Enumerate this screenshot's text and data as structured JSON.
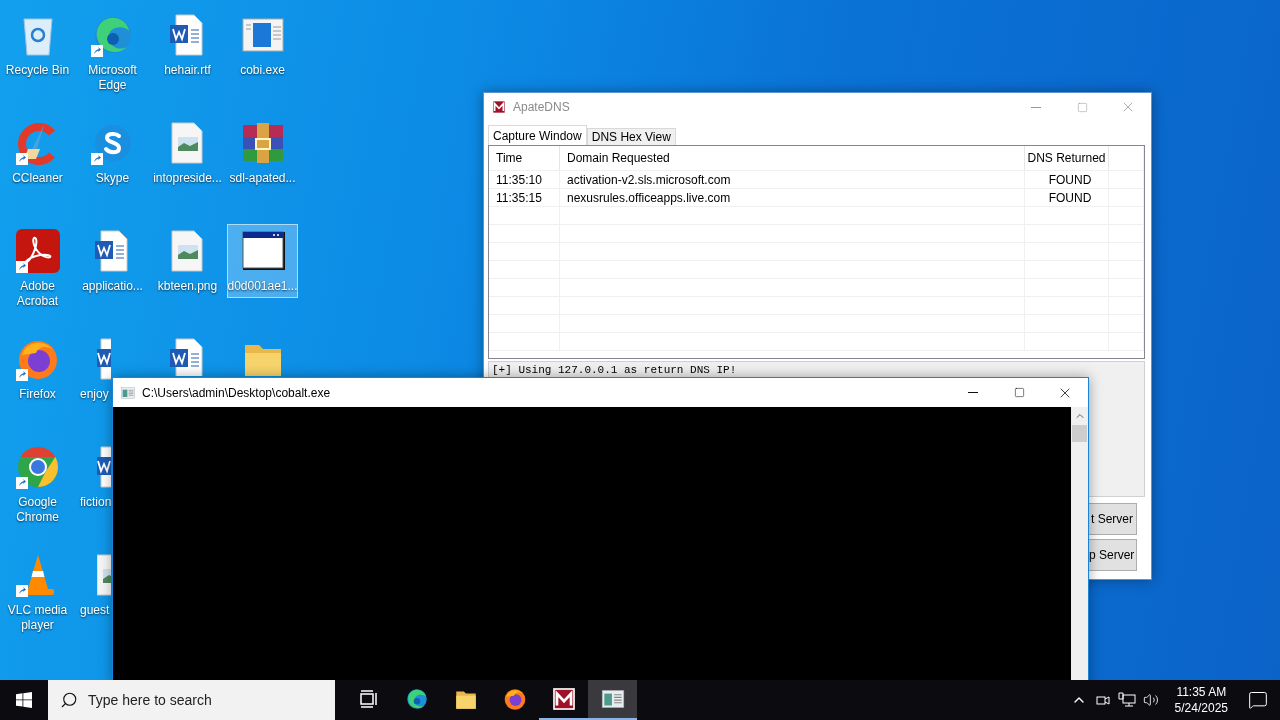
{
  "desktop_icons": [
    {
      "label": "Recycle Bin",
      "kind": "recycle",
      "shortcut": false,
      "selected": false
    },
    {
      "label": "Microsoft Edge",
      "kind": "edge",
      "shortcut": true,
      "selected": false
    },
    {
      "label": "hehair.rtf",
      "kind": "word",
      "shortcut": false,
      "selected": false
    },
    {
      "label": "cobi.exe",
      "kind": "exe",
      "shortcut": false,
      "selected": false
    },
    {
      "label": "CCleaner",
      "kind": "ccleaner",
      "shortcut": true,
      "selected": false
    },
    {
      "label": "Skype",
      "kind": "skype",
      "shortcut": true,
      "selected": false
    },
    {
      "label": "intopreside...",
      "kind": "image",
      "shortcut": false,
      "selected": false
    },
    {
      "label": "sdl-apated...",
      "kind": "archive",
      "shortcut": false,
      "selected": false
    },
    {
      "label": "Adobe Acrobat",
      "kind": "acrobat",
      "shortcut": true,
      "selected": false
    },
    {
      "label": "applicatio...",
      "kind": "word",
      "shortcut": false,
      "selected": false
    },
    {
      "label": "kbteen.png",
      "kind": "image",
      "shortcut": false,
      "selected": false
    },
    {
      "label": "d0d001ae1...",
      "kind": "app",
      "shortcut": false,
      "selected": true
    },
    {
      "label": "Firefox",
      "kind": "firefox",
      "shortcut": true,
      "selected": false
    },
    {
      "label": "enjoy",
      "kind": "word",
      "shortcut": false,
      "selected": false
    },
    {
      "kind": "word",
      "shortcut": false,
      "selected": false
    },
    {
      "kind": "folder",
      "shortcut": false,
      "selected": false
    },
    {
      "label": "Google Chrome",
      "kind": "chrome",
      "shortcut": true,
      "selected": false
    },
    {
      "label": "fiction",
      "kind": "word",
      "shortcut": false,
      "selected": false
    },
    {
      "kind": "none"
    },
    {
      "kind": "none"
    },
    {
      "label": "VLC media player",
      "kind": "vlc",
      "shortcut": true,
      "selected": false
    },
    {
      "label": "guest",
      "kind": "image",
      "shortcut": false,
      "selected": false
    }
  ],
  "windows": [
    {
      "kind": "dns-tool",
      "title": "ApateDNS",
      "active": false,
      "tabs": [
        {
          "label": "Capture Window",
          "selected": true
        },
        {
          "label": "DNS Hex View",
          "selected": false
        }
      ],
      "table": {
        "columns": [
          "Time",
          "Domain Requested",
          "DNS Returned"
        ],
        "rows": [
          [
            "11:35:10",
            "activation-v2.sls.microsoft.com",
            "FOUND"
          ],
          [
            "11:35:15",
            "nexusrules.officeapps.live.com",
            "FOUND"
          ]
        ]
      },
      "log": [
        "[+] Using 127.0.0.1 as return DNS IP!"
      ],
      "buttons": [
        "t Server",
        "p Server"
      ]
    },
    {
      "kind": "console",
      "title": "C:\\Users\\admin\\Desktop\\cobalt.exe",
      "active": true
    }
  ],
  "taskbar": {
    "search": {
      "placeholder": "Type here to search"
    },
    "apps": [
      {
        "kind": "task-view",
        "running": false,
        "active": false
      },
      {
        "kind": "edge",
        "running": false,
        "active": false
      },
      {
        "kind": "folder",
        "running": false,
        "active": false
      },
      {
        "kind": "firefox",
        "running": false,
        "active": false
      },
      {
        "kind": "dns-tool",
        "running": true,
        "active": false
      },
      {
        "kind": "console",
        "running": true,
        "active": true
      }
    ],
    "clock": {
      "time": "11:35 AM",
      "date": "5/24/2025"
    }
  }
}
